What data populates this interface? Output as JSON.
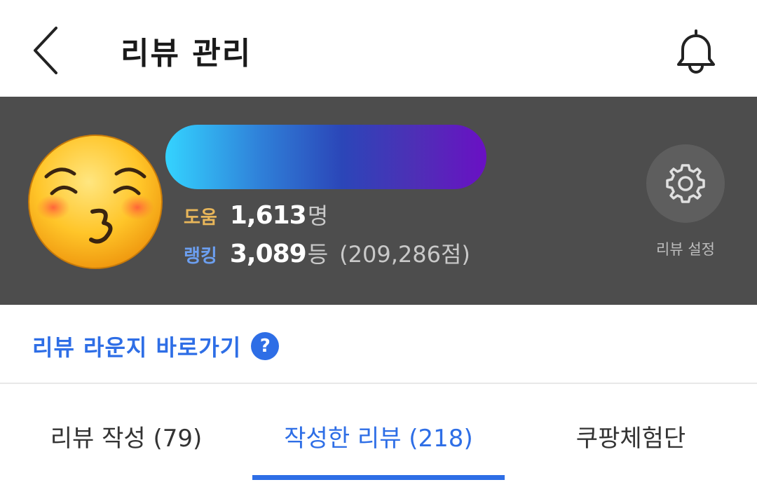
{
  "header": {
    "title": "리뷰 관리",
    "back_icon": "chevron-left-icon",
    "bell_icon": "bell-icon"
  },
  "profile": {
    "avatar_icon": "kissing-face-emoji",
    "grade_bar_colors": [
      "#34d3ff",
      "#2b46b8",
      "#6a10c4"
    ],
    "help_label": "도움",
    "help_value": "1,613",
    "help_unit": "명",
    "rank_label": "랭킹",
    "rank_value": "3,089",
    "rank_unit": "등",
    "rank_points": "(209,286점)",
    "settings_icon": "gear-icon",
    "settings_label": "리뷰 설정"
  },
  "lounge": {
    "link_text": "리뷰 라운지 바로가기",
    "help_icon_glyph": "?"
  },
  "tabs": [
    {
      "label": "리뷰 작성 (79)",
      "active": false
    },
    {
      "label": "작성한 리뷰 (218)",
      "active": true
    },
    {
      "label": "쿠팡체험단",
      "active": false
    }
  ],
  "colors": {
    "accent": "#2e6ee6",
    "banner_bg": "#4d4d4d",
    "help_label": "#e8b65a",
    "rank_label": "#6c9ff0"
  }
}
